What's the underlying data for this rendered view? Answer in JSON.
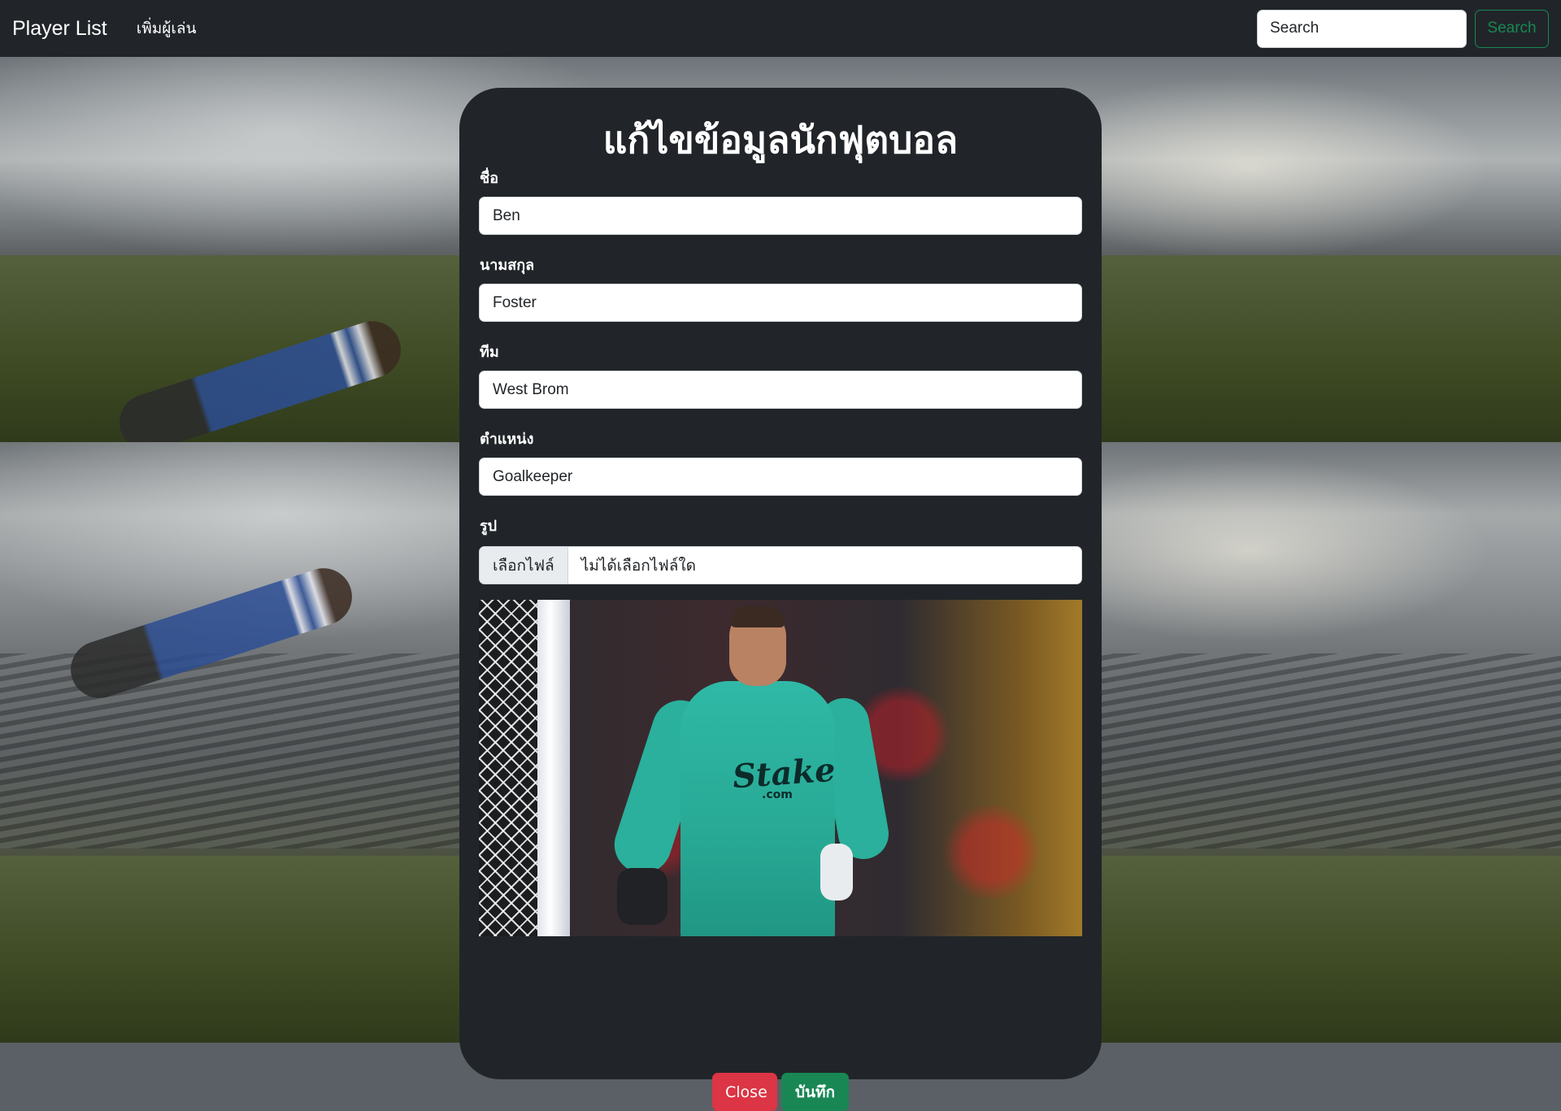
{
  "navbar": {
    "brand": "Player List",
    "add_player_link": "เพิ่มผู้เล่น",
    "search_placeholder": "Search",
    "search_button": "Search"
  },
  "modal": {
    "title": "แก้ไขข้อมูลนักฟุตบอล",
    "fields": [
      {
        "label": "ชื่อ",
        "value": "Ben"
      },
      {
        "label": "นามสกุล",
        "value": "Foster"
      },
      {
        "label": "ทีม",
        "value": "West Brom"
      },
      {
        "label": "ตำแหน่ง",
        "value": "Goalkeeper"
      }
    ],
    "image_label": "รูป",
    "file_button": "เลือกไฟล์",
    "file_status": "ไม่ได้เลือกไฟล์ใด",
    "photo_text": {
      "sponsor": "Stake",
      "sponsor_sub": ".com"
    },
    "close_button": "Close",
    "save_button": "บันทึก"
  },
  "colors": {
    "navbar_bg": "#212529",
    "modal_bg": "#212529",
    "close": "#dc3545",
    "save": "#198754",
    "search_outline": "#198754"
  }
}
